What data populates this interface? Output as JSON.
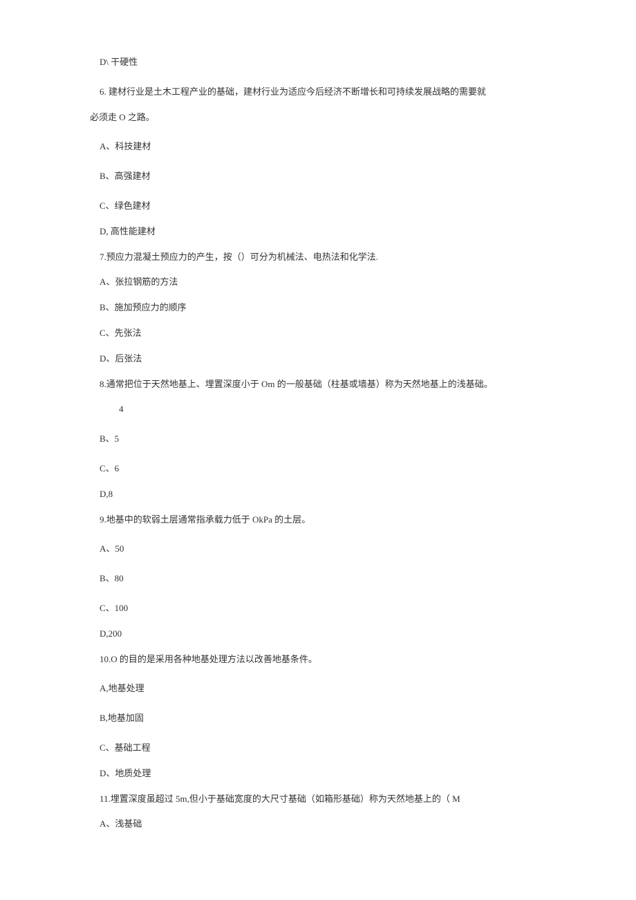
{
  "lines": [
    {
      "text": "D\\ 干硬性",
      "cls": "line indent-1"
    },
    {
      "text": "6.  建材行业是土木工程产业的基础，建材行业为适应今后经济不断增长和可持续发展战略的需要就",
      "cls": "line-tight q6-intro"
    },
    {
      "text": "必须走 O 之路。",
      "cls": "line q6-continue"
    },
    {
      "text": "A、科技建材",
      "cls": "line indent-1"
    },
    {
      "text": "B、高强建材",
      "cls": "line indent-1"
    },
    {
      "text": "C、绿色建材",
      "cls": "line-tight indent-1"
    },
    {
      "text": "D, 高性能建材",
      "cls": "line-tight indent-1"
    },
    {
      "text": "7.预应力混凝土预应力的产生，按（）可分为机械法、电热法和化学法.",
      "cls": "line-tight indent-1"
    },
    {
      "text": "A、张拉钢筋的方法",
      "cls": "line-tight indent-1"
    },
    {
      "text": "B、施加预应力的顺序",
      "cls": "line-tight indent-1"
    },
    {
      "text": "C、先张法",
      "cls": "line-tight indent-1"
    },
    {
      "text": "D、后张法",
      "cls": "line-tight indent-1"
    },
    {
      "text": "8.通常把位于天然地基上、埋置深度小于 Om 的一般基础（柱基或墙基）称为天然地基上的浅基础。",
      "cls": "line-tight indent-1"
    },
    {
      "text": "4",
      "cls": "line indent-2"
    },
    {
      "text": "B、5",
      "cls": "line indent-1"
    },
    {
      "text": "C、6",
      "cls": "line-tight indent-1"
    },
    {
      "text": "D,8",
      "cls": "line-tight indent-1"
    },
    {
      "text": "9.地基中的软弱土层通常指承载力低于 OkPa 的土层。",
      "cls": "line indent-1"
    },
    {
      "text": "A、50",
      "cls": "line indent-1"
    },
    {
      "text": "B、80",
      "cls": "line indent-1"
    },
    {
      "text": "C、100",
      "cls": "line-tight indent-1"
    },
    {
      "text": "D,200",
      "cls": "line-tight indent-1"
    },
    {
      "text": "10.O 的目的是采用各种地基处理方法以改善地基条件。",
      "cls": "line indent-1"
    },
    {
      "text": "A,地基处理",
      "cls": "line indent-1"
    },
    {
      "text": "B,地基加固",
      "cls": "line indent-1"
    },
    {
      "text": "C、基础工程",
      "cls": "line-tight indent-1"
    },
    {
      "text": "D、地质处理",
      "cls": "line-tight indent-1"
    },
    {
      "text": "11.埋置深度虽超过 5m,但小于基础宽度的大尺寸基础（如箱形基础）称为天然地基上的（ M",
      "cls": "line-tight indent-1"
    },
    {
      "text": "A、浅基础",
      "cls": "line-tight indent-1"
    }
  ]
}
